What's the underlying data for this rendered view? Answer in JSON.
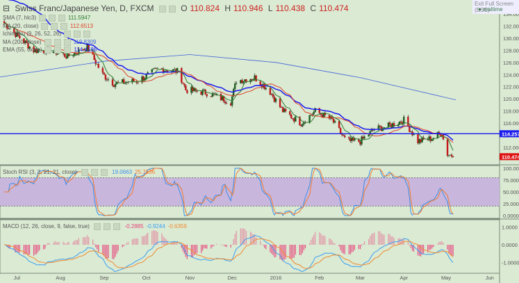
{
  "header": {
    "title": "Swiss Franc/Japanese Yen, D, FXCM",
    "o_label": "O",
    "o": "110.824",
    "h_label": "H",
    "h": "110.946",
    "l_label": "L",
    "l": "110.438",
    "c_label": "C",
    "c": "110.474",
    "exit_fullscreen": "Exit Full Screen (ESC)",
    "realtime": "realtime"
  },
  "indicators": [
    {
      "label": "SMA (7, hlc3)",
      "value": "111.5947",
      "color": "#2e7d32"
    },
    {
      "label": "MA (20, close)",
      "value": "112.6513",
      "color": "#e0412a"
    },
    {
      "label": "Ichimoku (9, 26, 52, 26)",
      "value": "",
      "color": "#555"
    },
    {
      "label": "MA (200, close)",
      "value": "119.8309",
      "color": "#3b5fd9"
    },
    {
      "label": "EMA (55, close)",
      "value": "114.4186",
      "color": "#1a1aee"
    }
  ],
  "stoch": {
    "label": "Stoch RSI (3, 3, 21, 21, close)",
    "k": "19.0663",
    "d": "25.7636",
    "k_color": "#3a8ee6",
    "d_color": "#f07a30",
    "band_color": "#c9b6dc"
  },
  "macd": {
    "label": "MACD (12, 26, close, 9, false, true)",
    "hist": "-0.2885",
    "macd": "-0.9244",
    "signal": "-0.6359",
    "hist_color": "#e8407a",
    "macd_color": "#3a9ef0",
    "signal_color": "#f08a30"
  },
  "chart_data": {
    "type": "candlestick",
    "price_axis": {
      "range": [
        110,
        135
      ],
      "ticks": [
        "134.000",
        "132.000",
        "130.000",
        "128.000",
        "126.000",
        "124.000",
        "122.000",
        "120.000",
        "118.000",
        "116.000",
        "114.000",
        "112.000"
      ]
    },
    "stoch_axis": {
      "range": [
        0,
        100
      ],
      "ticks": [
        "100.0000",
        "75.0000",
        "50.0000",
        "25.0000",
        "0.0000"
      ],
      "bands": [
        20,
        80
      ]
    },
    "macd_axis": {
      "range": [
        -1.5,
        1.5
      ],
      "ticks": [
        "1.0000",
        "0.0000",
        "-1.0000"
      ]
    },
    "x_ticks": [
      [
        "2015-07-01",
        "Jul"
      ],
      [
        "2015-08-01",
        "Aug"
      ],
      [
        "2015-09-01",
        "Sep"
      ],
      [
        "2015-10-01",
        "Oct"
      ],
      [
        "2015-11-01",
        "Nov"
      ],
      [
        "2015-12-01",
        "Dec"
      ],
      [
        "2016-01-01",
        "2016"
      ],
      [
        "2016-02-01",
        "Feb"
      ],
      [
        "2016-03-01",
        "Mar"
      ],
      [
        "2016-04-01",
        "Apr"
      ],
      [
        "2016-05-01",
        "May"
      ],
      [
        "2016-06-01",
        "Jun"
      ]
    ],
    "x_range": [
      "2015-06-19",
      "2016-06-08"
    ],
    "close_path": [
      [
        "2015-06-22",
        132.5
      ],
      [
        "2015-07-01",
        130.5
      ],
      [
        "2015-07-13",
        128
      ],
      [
        "2015-07-25",
        128
      ],
      [
        "2015-08-06",
        127
      ],
      [
        "2015-08-20",
        128.5
      ],
      [
        "2015-08-31",
        124
      ],
      [
        "2015-09-08",
        122.5
      ],
      [
        "2015-09-25",
        123
      ],
      [
        "2015-10-10",
        125
      ],
      [
        "2015-10-24",
        124.5
      ],
      [
        "2015-10-29",
        121.5
      ],
      [
        "2015-11-13",
        121
      ],
      [
        "2015-11-30",
        119.5
      ],
      [
        "2015-12-04",
        123
      ],
      [
        "2015-12-17",
        123.5
      ],
      [
        "2015-12-27",
        121.5
      ],
      [
        "2016-01-06",
        118
      ],
      [
        "2016-01-19",
        116
      ],
      [
        "2016-01-29",
        118
      ],
      [
        "2016-02-10",
        116.5
      ],
      [
        "2016-02-20",
        113
      ],
      [
        "2016-03-01",
        113
      ],
      [
        "2016-03-11",
        115
      ],
      [
        "2016-03-21",
        115.5
      ],
      [
        "2016-04-01",
        116.5
      ],
      [
        "2016-04-11",
        113
      ],
      [
        "2016-04-21",
        113.5
      ],
      [
        "2016-04-28",
        114.5
      ],
      [
        "2016-05-01",
        111
      ],
      [
        "2016-05-08",
        110.474
      ]
    ],
    "ma200_path": [
      [
        "2015-06-19",
        123.6
      ],
      [
        "2015-09-01",
        126.2
      ],
      [
        "2015-11-01",
        127.3
      ],
      [
        "2016-01-01",
        126
      ],
      [
        "2016-03-01",
        123.5
      ],
      [
        "2016-05-08",
        119.83
      ]
    ],
    "hline": {
      "value": 114.257,
      "label": "114.257",
      "color": "#1a1aee"
    },
    "last_price": {
      "value": 110.474,
      "label": "110.474",
      "color": "#d11"
    },
    "up_color": "#1e5e1e",
    "down_color": "#c01818"
  }
}
